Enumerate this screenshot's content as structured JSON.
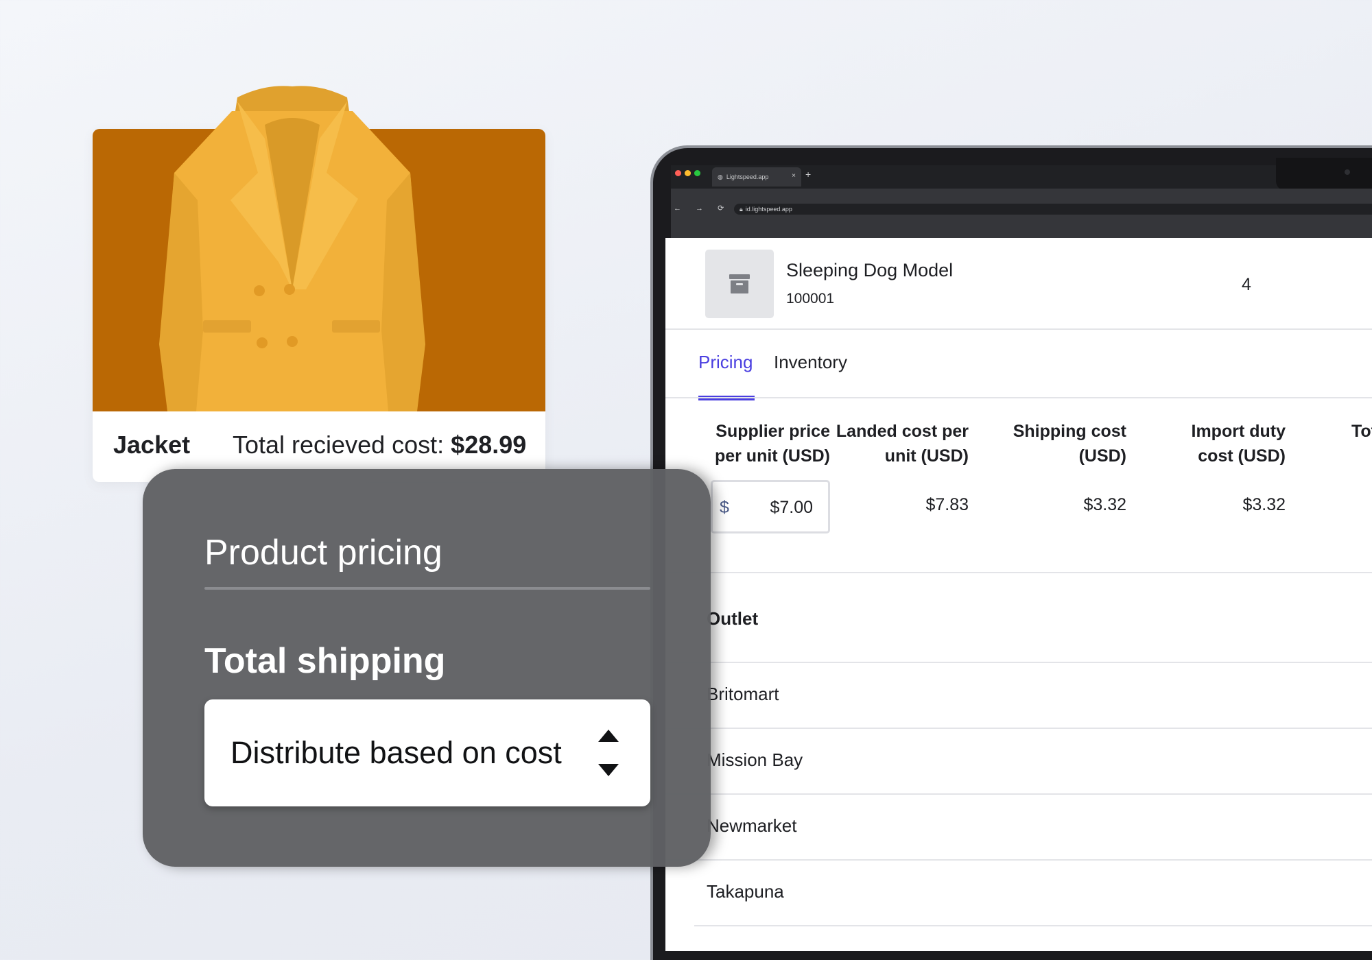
{
  "browser": {
    "tab_title": "Lightspeed.app",
    "tab_close": "×",
    "new_tab": "+",
    "nav_glyphs": "← → ⟳ ⌂",
    "url": "id.lightspeed.app",
    "traffic_colors": [
      "#ff5f57",
      "#febc2e",
      "#28c840"
    ]
  },
  "product": {
    "name": "Sleeping Dog Model",
    "sku": "100001",
    "quantity": "4",
    "thumbnail_icon": "archive-box-icon"
  },
  "tabs": [
    {
      "label": "Pricing",
      "active": true
    },
    {
      "label": "Inventory",
      "active": false
    }
  ],
  "pricing_table": {
    "headers": [
      [
        "Supplier price",
        "per unit (USD)"
      ],
      [
        "Landed cost per",
        "unit (USD)"
      ],
      [
        "Shipping cost",
        "(USD)"
      ],
      [
        "Import duty",
        "cost (USD)"
      ],
      [
        "Tot",
        ""
      ]
    ],
    "supplier_currency": "$",
    "supplier_price": "$7.00",
    "landed_cost": "$7.83",
    "shipping_cost": "$3.32",
    "import_duty": "$3.32"
  },
  "outlets": {
    "header": "Outlet",
    "rows": [
      "Britomart",
      "Mission Bay",
      "Newmarket",
      "Takapuna"
    ]
  },
  "card": {
    "label": "Jacket",
    "cost_label": "Total recieved cost:",
    "cost_value": "$28.99",
    "photo_color": "#ba6804",
    "jacket_color": "#f2b13a"
  },
  "overlay": {
    "title": "Product pricing",
    "subtitle": "Total shipping",
    "select_value": "Distribute based on cost"
  },
  "colors": {
    "accent": "#4a3fe0",
    "overlay": "#606164"
  }
}
